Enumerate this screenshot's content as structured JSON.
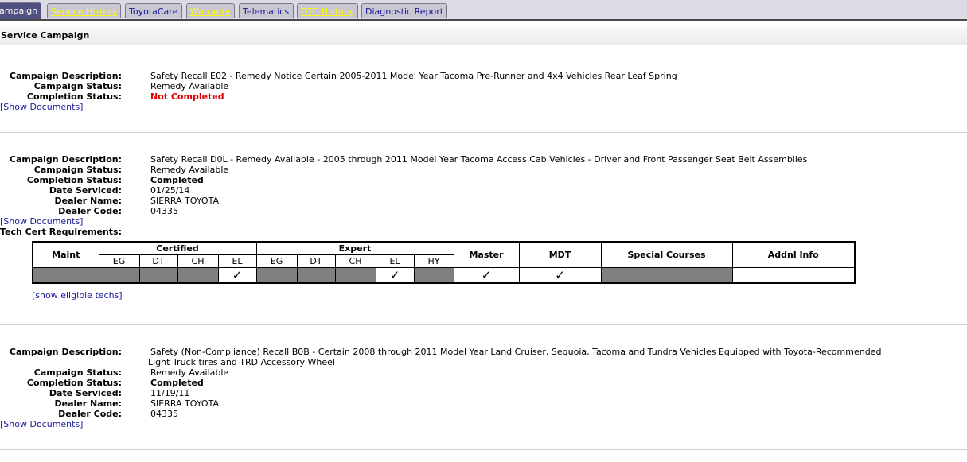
{
  "tabs": [
    {
      "label": "ampaign",
      "state": "active"
    },
    {
      "label": "Service History",
      "state": "alert"
    },
    {
      "label": "ToyotaCare",
      "state": "normal"
    },
    {
      "label": "Warranty",
      "state": "alert"
    },
    {
      "label": "Telematics",
      "state": "normal"
    },
    {
      "label": "DTC History",
      "state": "alert"
    },
    {
      "label": "Diagnostic Report",
      "state": "normal"
    }
  ],
  "section_title": "Service Campaign",
  "labels": {
    "description": "Campaign Description:",
    "status": "Campaign Status:",
    "completion": "Completion Status:",
    "date": "Date Serviced:",
    "dealer_name": "Dealer Name:",
    "dealer_code": "Dealer Code:",
    "tech_cert": "Tech Cert Requirements:"
  },
  "show_documents_label": "[Show Documents]",
  "campaigns": [
    {
      "description": "Safety Recall E02 - Remedy Notice Certain 2005-2011 Model Year Tacoma Pre-Runner and 4x4 Vehicles Rear Leaf Spring",
      "status": "Remedy Available",
      "completion": "Not Completed"
    },
    {
      "description": "Safety Recall D0L - Remedy Avaliable - 2005 through 2011 Model Year Tacoma Access Cab Vehicles - Driver and Front Passenger Seat Belt Assemblies",
      "status": "Remedy Available",
      "completion": "Completed",
      "date_serviced": "01/25/14",
      "dealer_name": "SIERRA TOYOTA",
      "dealer_code": "04335"
    },
    {
      "description_line1": "Safety (Non-Compliance) Recall B0B - Certain 2008 through 2011 Model Year Land Cruiser, Sequoia, Tacoma and Tundra Vehicles Equipped with Toyota-Recommended",
      "description_line2": "Light Truck tires and TRD Accessory Wheel",
      "status": "Remedy Available",
      "completion": "Completed",
      "date_serviced": "11/19/11",
      "dealer_name": "SIERRA TOYOTA",
      "dealer_code": "04335"
    }
  ],
  "cert_table": {
    "headers": {
      "maint": "Maint",
      "certified": "Certified",
      "expert": "Expert",
      "master": "Master",
      "mdt": "MDT",
      "special": "Special Courses",
      "addnl": "Addnl Info"
    },
    "certified_sub": [
      "EG",
      "DT",
      "CH",
      "EL"
    ],
    "expert_sub": [
      "EG",
      "DT",
      "CH",
      "EL",
      "HY"
    ],
    "checkmark": "✓",
    "requirements": {
      "maint": false,
      "certified": [
        false,
        false,
        false,
        true
      ],
      "expert": [
        false,
        false,
        false,
        true,
        false
      ],
      "master": true,
      "mdt": true,
      "special": false
    },
    "show_eligible_label": "[show eligible techs]"
  },
  "colors": {
    "tab_active_bg": "#4f4f80",
    "tab_alert_text": "#ffff00",
    "link": "#1a1a9a",
    "not_completed": "#e00000",
    "required_cell": "#808080"
  }
}
